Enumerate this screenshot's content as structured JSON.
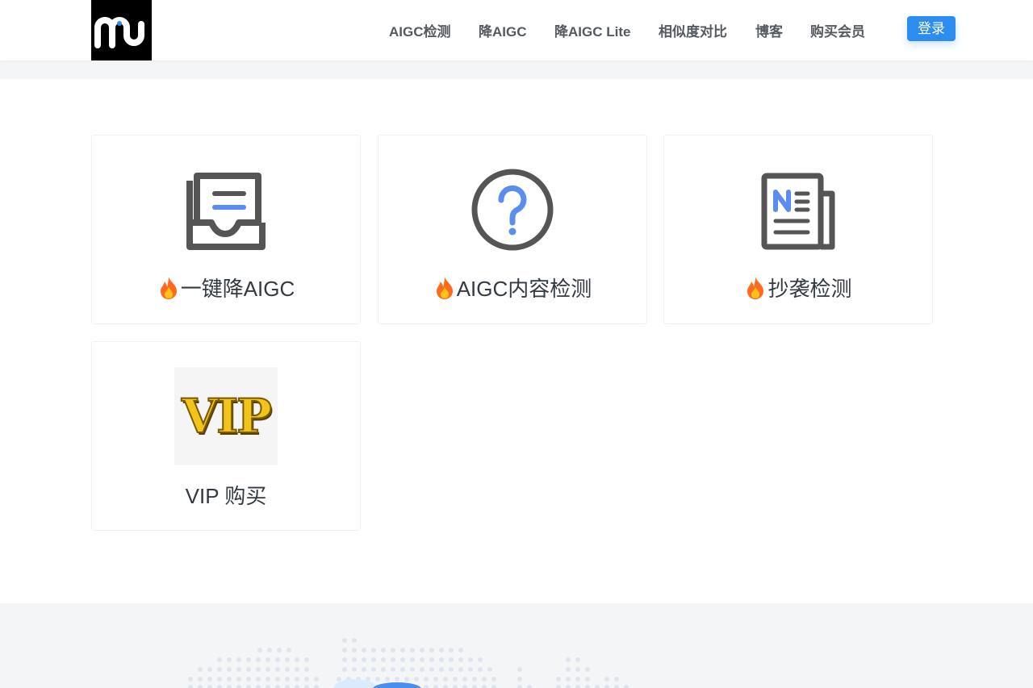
{
  "header": {
    "nav": [
      {
        "label": "AIGC检测"
      },
      {
        "label": "降AIGC"
      },
      {
        "label": "降AIGC Lite"
      },
      {
        "label": "相似度对比"
      },
      {
        "label": "博客"
      },
      {
        "label": "购买会员"
      }
    ],
    "login_label": "登录"
  },
  "cards": [
    {
      "label": "一键降AIGC",
      "icon": "inbox-document-icon",
      "fire": true
    },
    {
      "label": "AIGC内容检测",
      "icon": "question-circle-icon",
      "fire": true
    },
    {
      "label": "抄袭检测",
      "icon": "newspaper-icon",
      "fire": true
    },
    {
      "label": "VIP 购买",
      "icon": "vip-badge-image",
      "fire": false
    }
  ],
  "vip_image_text": "VIP",
  "colors": {
    "accent": "#2d8cf0",
    "icon_gray": "#555555",
    "icon_blue": "#5b8def",
    "fire": "#ff6a1f"
  }
}
